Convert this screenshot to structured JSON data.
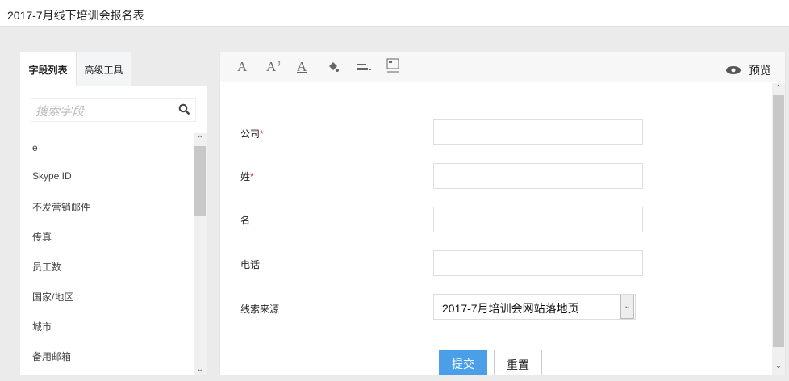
{
  "title": "2017-7月线下培训会报名表",
  "tabs": [
    "字段列表",
    "高级工具"
  ],
  "search": {
    "placeholder": "搜索字段"
  },
  "fields": [
    "e",
    "Skype ID",
    "不发营销邮件",
    "传真",
    "员工数",
    "国家/地区",
    "城市",
    "备用邮箱"
  ],
  "toolbar": {
    "icons": [
      "font-icon",
      "font-size-icon",
      "font-color-icon",
      "fill-color-icon",
      "line-style-icon",
      "layout-width-icon"
    ],
    "preview": "预览"
  },
  "form": {
    "rows": [
      {
        "label": "公司",
        "required": true
      },
      {
        "label": "姓",
        "required": true
      },
      {
        "label": "名",
        "required": false
      },
      {
        "label": "电话",
        "required": false
      }
    ],
    "source_label": "线索来源",
    "source_value": "2017-7月培训会网站落地页",
    "submit": "提交",
    "reset": "重置"
  },
  "colors": {
    "accent": "#4a9fe8",
    "required": "#e33333"
  }
}
